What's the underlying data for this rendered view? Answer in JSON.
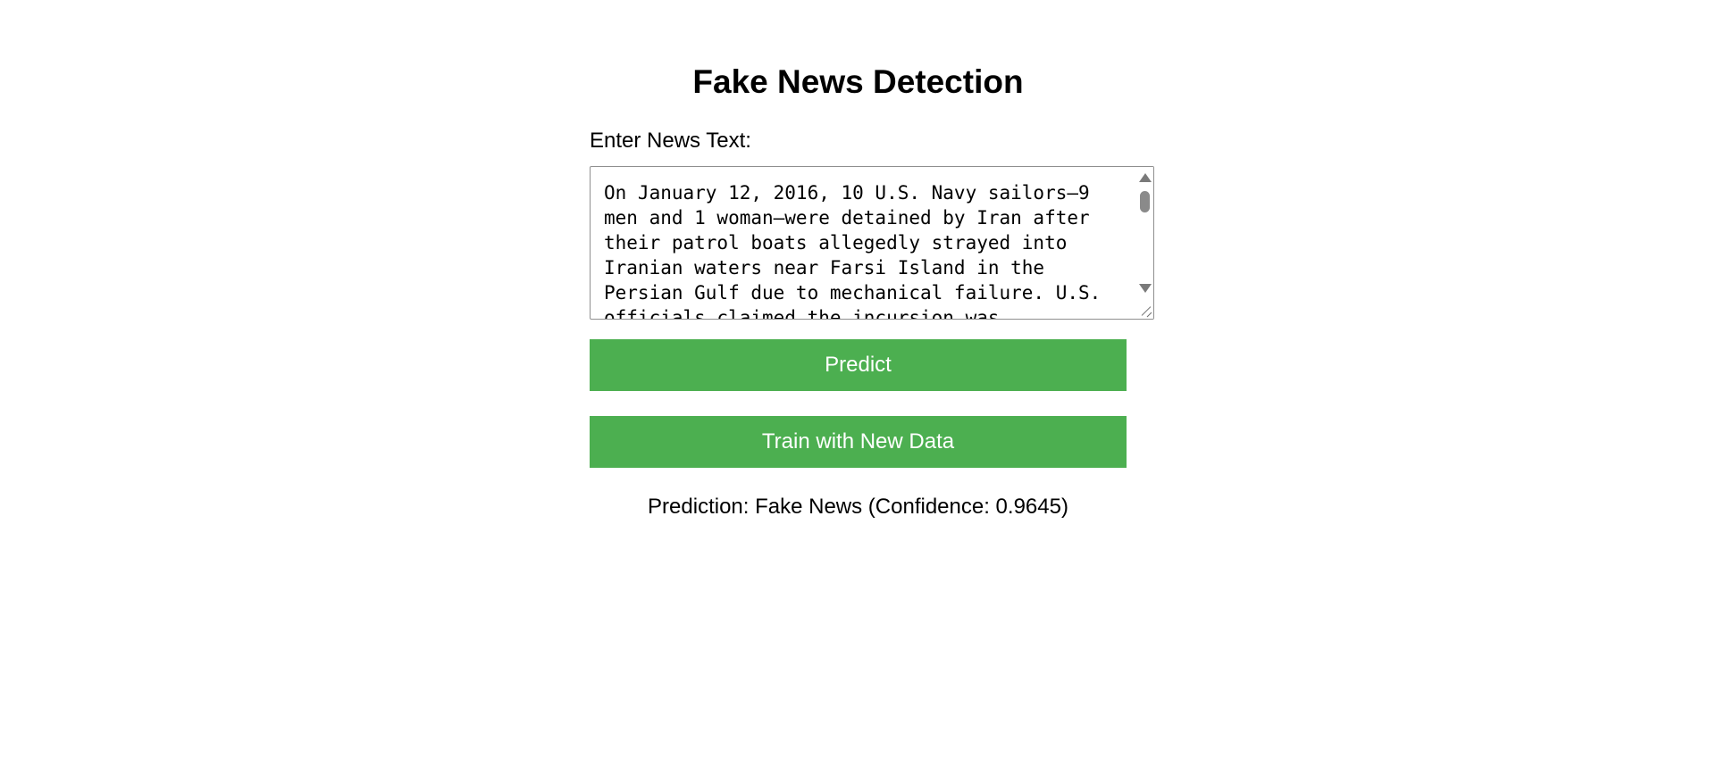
{
  "page": {
    "title": "Fake News Detection",
    "input_label": "Enter News Text:",
    "news_text": "On January 12, 2016, 10 U.S. Navy sailors—9 men and 1 woman—were detained by Iran after their patrol boats allegedly strayed into Iranian waters near Farsi Island in the Persian Gulf due to mechanical failure. U.S. officials claimed the incursion was"
  },
  "buttons": {
    "predict_label": "Predict",
    "train_label": "Train with New Data"
  },
  "result": {
    "text": "Prediction: Fake News (Confidence: 0.9645)"
  },
  "colors": {
    "button_bg": "#4caf50",
    "button_text": "#ffffff"
  },
  "icons": {
    "scroll_up": "scroll-up-arrow-icon",
    "scroll_down": "scroll-down-arrow-icon",
    "resize": "resize-grip-icon"
  }
}
